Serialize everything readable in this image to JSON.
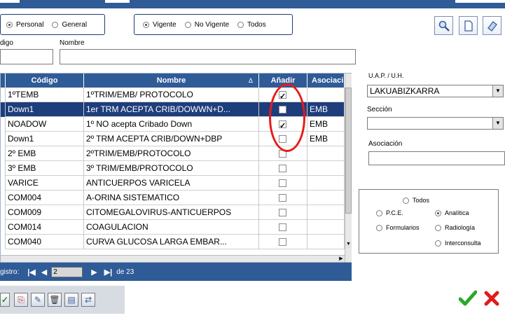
{
  "filters": {
    "type_options": [
      {
        "label": "Personal",
        "selected": true
      },
      {
        "label": "General",
        "selected": false
      }
    ],
    "status_options": [
      {
        "label": "Vigente",
        "selected": true
      },
      {
        "label": "No Vigente",
        "selected": false
      },
      {
        "label": "Todos",
        "selected": false
      }
    ]
  },
  "search": {
    "code_label": "digo",
    "name_label": "Nombre",
    "code_value": "",
    "name_value": ""
  },
  "toolbar_icons": [
    "search-icon",
    "document-icon",
    "eraser-icon"
  ],
  "grid": {
    "headers": [
      "Código",
      "Nombre",
      "Añadir",
      "Asociaci"
    ],
    "sort_indicator": "Δ",
    "rows": [
      {
        "code": "1ºTEMB",
        "name": " 1ºTRIM/EMB/ PROTOCOLO",
        "add": true,
        "assoc": "",
        "selected": false
      },
      {
        "code": "Down1",
        "name": "1er TRM ACEPTA CRIB/DOWWN+D...",
        "add": false,
        "assoc": "EMB",
        "selected": true
      },
      {
        "code": "NOADOW",
        "name": "1º  NO  acepta Cribado Down",
        "add": true,
        "assoc": "EMB",
        "selected": false
      },
      {
        "code": "Down1",
        "name": "2º TRM ACEPTA CRIB/DOWN+DBP",
        "add": false,
        "assoc": "EMB",
        "selected": false
      },
      {
        "code": "2º EMB",
        "name": "2ºTRIM/EMB/PROTOCOLO",
        "add": false,
        "assoc": "",
        "selected": false
      },
      {
        "code": "3º EMB",
        "name": "3º TRIM/EMB/PROTOCOLO",
        "add": false,
        "assoc": "",
        "selected": false
      },
      {
        "code": "VARICE",
        "name": "ANTICUERPOS VARICELA",
        "add": false,
        "assoc": "",
        "selected": false
      },
      {
        "code": "COM004",
        "name": "A-ORINA SISTEMATICO",
        "add": false,
        "assoc": "",
        "selected": false
      },
      {
        "code": "COM009",
        "name": "CITOMEGALOVIRUS-ANTICUERPOS",
        "add": false,
        "assoc": "",
        "selected": false
      },
      {
        "code": "COM014",
        "name": "COAGULACION",
        "add": false,
        "assoc": "",
        "selected": false
      },
      {
        "code": "COM040",
        "name": "CURVA GLUCOSA LARGA EMBAR...",
        "add": false,
        "assoc": "",
        "selected": false
      }
    ]
  },
  "pager": {
    "label": "gistro:",
    "current": "2",
    "total_text": "de 23"
  },
  "right_panel": {
    "uap_label": "U.A.P. / U.H.",
    "uap_value": "LAKUABIZKARRA",
    "section_label": "Sección",
    "section_value": "",
    "assoc_label": "Asociación",
    "assoc_value": ""
  },
  "category_filter": [
    {
      "label": "Todos",
      "selected": false
    },
    {
      "label": "P.C.E.",
      "selected": false
    },
    {
      "label": "Analítica",
      "selected": true
    },
    {
      "label": "Formularios",
      "selected": false
    },
    {
      "label": "Radiología",
      "selected": false
    },
    {
      "label": "Interconsulta",
      "selected": false
    }
  ],
  "bottom_tools": [
    "new-icon",
    "copy-icon",
    "edit-icon",
    "delete-icon",
    "paste-icon",
    "link-icon"
  ],
  "actions": {
    "ok_icon": "checkmark-icon",
    "cancel_icon": "close-icon"
  },
  "colors": {
    "header_blue": "#2f5b97",
    "selected_row": "#1e3d7b",
    "annotation_red": "#e81a1a"
  }
}
